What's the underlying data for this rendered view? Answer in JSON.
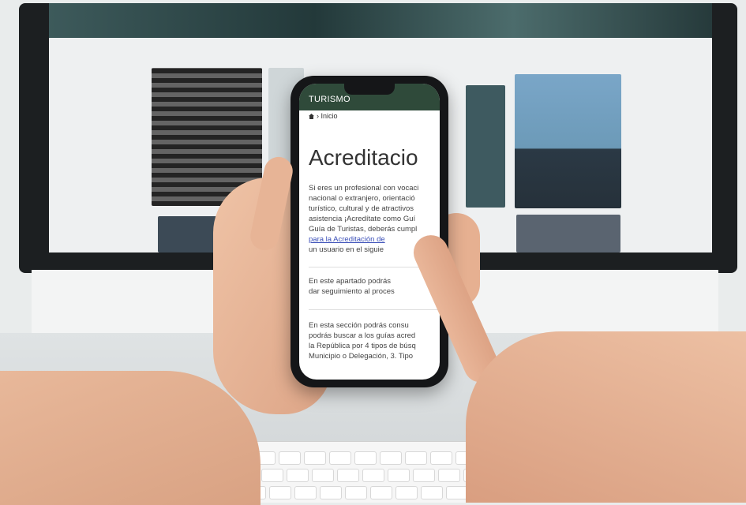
{
  "phone_app": {
    "header_title": "TURISMO",
    "breadcrumb": "› Inicio",
    "heading": "Acreditacio",
    "paragraph1": [
      "Si eres un profesional con vocaci",
      "nacional o extranjero, orientació",
      "turístico, cultural y de atractivos",
      "asistencia ¡Acredítate como Guí",
      "Guía de Turistas, deberás cumpl"
    ],
    "paragraph1_link": "para la Acreditación de",
    "paragraph1_tail": "un usuario en el siguie",
    "paragraph2": [
      "En este apartado podrás",
      "dar seguimiento al proces"
    ],
    "paragraph3": [
      "En esta sección podrás consu",
      "podrás buscar a los guías acred",
      "la República por 4 tipos de búsq",
      "Municipio o Delegación, 3. Tipo"
    ]
  },
  "colors": {
    "header_bg": "#2f4a3a",
    "link": "#3b4fb8"
  }
}
